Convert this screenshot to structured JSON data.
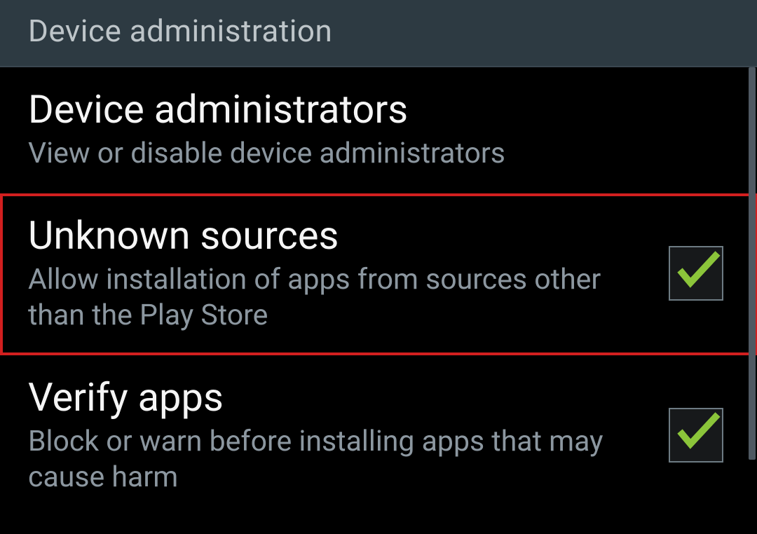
{
  "section": {
    "header": "Device administration"
  },
  "items": [
    {
      "title": "Device administrators",
      "subtitle": "View or disable device administrators",
      "has_checkbox": false,
      "highlighted": false
    },
    {
      "title": "Unknown sources",
      "subtitle": "Allow installation of apps from sources other than the Play Store",
      "has_checkbox": true,
      "checked": true,
      "highlighted": true
    },
    {
      "title": "Verify apps",
      "subtitle": "Block or warn before installing apps that may cause harm",
      "has_checkbox": true,
      "checked": true,
      "highlighted": false
    }
  ],
  "colors": {
    "check": "#8bc34a",
    "highlight_border": "#d21f1f"
  }
}
